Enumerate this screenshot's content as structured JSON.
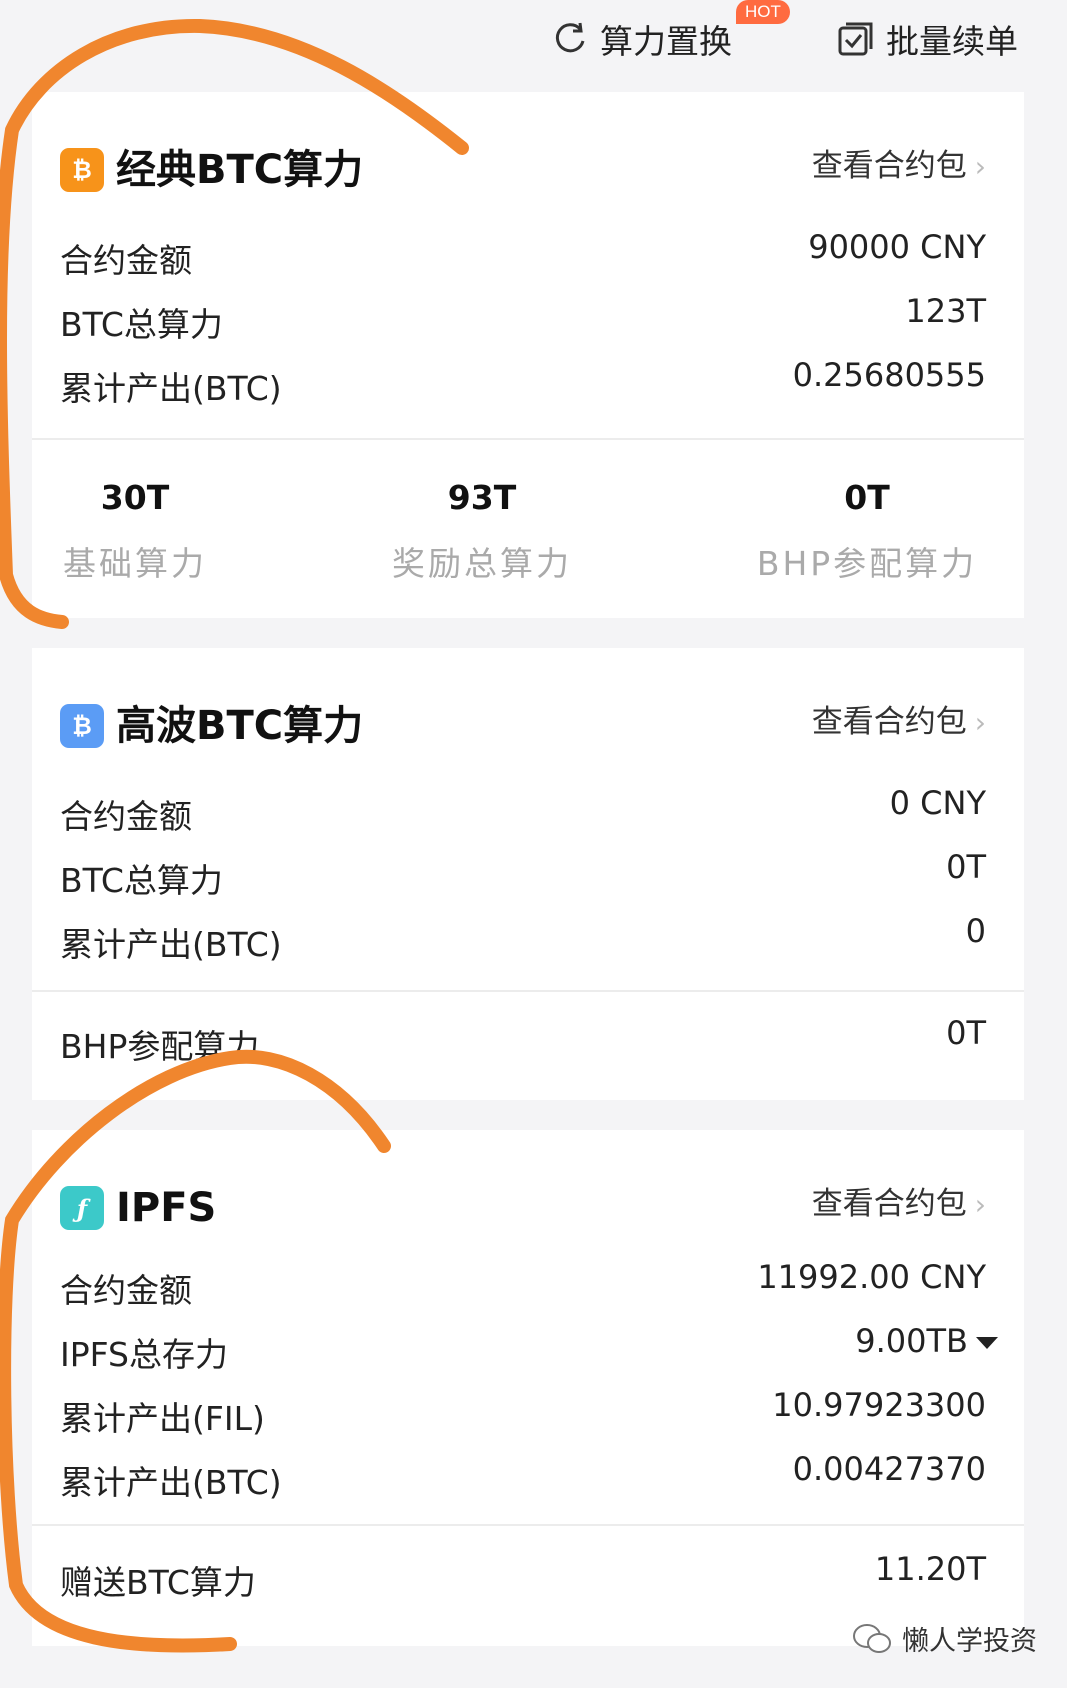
{
  "toolbar": {
    "swap_label": "算力置换",
    "hot_badge": "HOT",
    "batch_label": "批量续单"
  },
  "cards": {
    "classic": {
      "icon_name": "bitcoin-icon",
      "icon_color": "#f7931a",
      "title": "经典BTC算力",
      "view_link": "查看合约包",
      "rows": [
        {
          "label": "合约金额",
          "value": "90000 CNY"
        },
        {
          "label": "BTC总算力",
          "value": "123T"
        },
        {
          "label": "累计产出(BTC)",
          "value": "0.25680555"
        }
      ],
      "stats": [
        {
          "value": "30T",
          "caption": "基础算力"
        },
        {
          "value": "93T",
          "caption": "奖励总算力"
        },
        {
          "value": "0T",
          "caption": "BHP参配算力"
        }
      ]
    },
    "highwave": {
      "icon_name": "bitcoin-icon",
      "icon_color": "#5b9cf5",
      "title": "高波BTC算力",
      "view_link": "查看合约包",
      "rows": [
        {
          "label": "合约金额",
          "value": "0 CNY"
        },
        {
          "label": "BTC总算力",
          "value": "0T"
        },
        {
          "label": "累计产出(BTC)",
          "value": "0"
        }
      ],
      "footer": {
        "label": "BHP参配算力",
        "value": "0T"
      }
    },
    "ipfs": {
      "icon_name": "filecoin-icon",
      "icon_color": "#3cc9c9",
      "title": "IPFS",
      "view_link": "查看合约包",
      "rows": [
        {
          "label": "合约金额",
          "value": "11992.00 CNY"
        },
        {
          "label": "IPFS总存力",
          "value": "9.00TB"
        },
        {
          "label": "累计产出(FIL)",
          "value": "10.97923300"
        },
        {
          "label": "累计产出(BTC)",
          "value": "0.00427370"
        }
      ],
      "footer": {
        "label": "赠送BTC算力",
        "value": "11.20T"
      }
    }
  },
  "watermark": "懒人学投资",
  "annotation_color": "#f0862e"
}
